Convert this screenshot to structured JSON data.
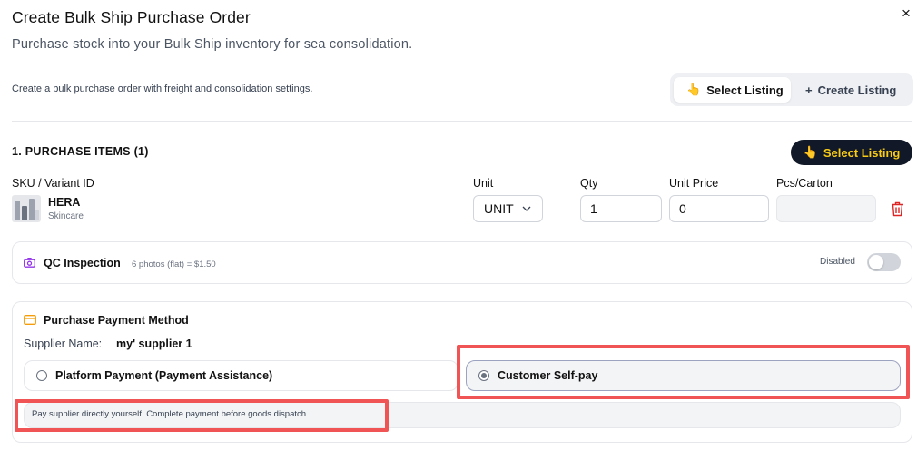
{
  "modal": {
    "title": "Create Bulk Ship Purchase Order",
    "subtitle": "Purchase stock into your Bulk Ship inventory for sea consolidation.",
    "close_glyph": "×"
  },
  "description": "Create a bulk purchase order with freight and consolidation settings.",
  "mode_toggle": {
    "select_icon": "👆",
    "select_label": "Select Listing",
    "create_icon": "+",
    "create_label": "Create Listing"
  },
  "purchase_items": {
    "title": "1. PURCHASE ITEMS (1)",
    "select_button_icon": "👆",
    "select_button_label": "Select Listing",
    "columns": {
      "sku": "SKU / Variant ID",
      "unit": "Unit",
      "qty": "Qty",
      "unit_price": "Unit Price",
      "pcs_carton": "Pcs/Carton"
    },
    "item": {
      "name": "HERA",
      "category": "Skincare",
      "unit": "UNIT",
      "qty": "1",
      "unit_price": "0",
      "pcs_carton": ""
    }
  },
  "qc_inspection": {
    "title": "QC Inspection",
    "note": "6 photos (flat) = $1.50",
    "status": "Disabled",
    "enabled": false
  },
  "payment": {
    "title": "Purchase Payment Method",
    "supplier_label": "Supplier Name:",
    "supplier_value": "my' supplier 1",
    "options": [
      {
        "label": "Platform Payment (Payment Assistance)",
        "selected": false
      },
      {
        "label": "Customer Self-pay",
        "selected": true
      }
    ],
    "hint": "Pay supplier directly yourself. Complete payment before goods dispatch."
  },
  "colors": {
    "accent_yellow": "#facc15",
    "dark_button": "#111827",
    "delete_red": "#dc2626",
    "qc_icon_purple": "#9333ea",
    "payment_icon_orange": "#f59e0b",
    "highlight_red": "#f05454"
  },
  "icons": [
    "close-icon",
    "pointing-hand-icon",
    "plus-icon",
    "chevron-down-icon",
    "trash-icon",
    "camera-icon",
    "credit-card-icon"
  ]
}
